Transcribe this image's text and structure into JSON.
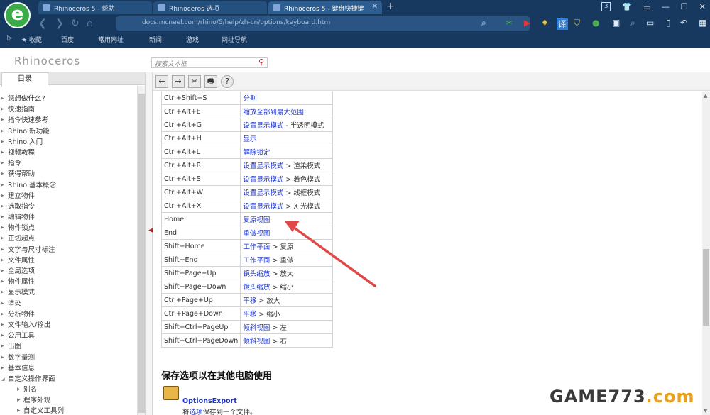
{
  "browser": {
    "logo": "e",
    "tabs": [
      "Rhinoceros 5 - 帮助",
      "Rhinoceros 选项",
      "Rhinoceros 5 - 键盘快捷键"
    ],
    "new_tab": "+",
    "tab_count": "3",
    "url": "docs.mcneel.com/rhino/5/help/zh-cn/options/keyboard.htm",
    "bookmarks": [
      "★ 收藏",
      "百度",
      "常用网址",
      "新闻",
      "游戏",
      "网址导航"
    ]
  },
  "app": {
    "title": "Rhinoceros",
    "search_placeholder": "搜索文本框",
    "toc_tab": "目录"
  },
  "toc": [
    {
      "label": "您想做什么?"
    },
    {
      "label": "快速指南"
    },
    {
      "label": "指令快速参考"
    },
    {
      "label": "Rhino 新功能"
    },
    {
      "label": "Rhino 入门"
    },
    {
      "label": "视频教程"
    },
    {
      "label": "指令"
    },
    {
      "label": "获得帮助"
    },
    {
      "label": "Rhino 基本概念"
    },
    {
      "label": "建立物件"
    },
    {
      "label": "选取指令"
    },
    {
      "label": "编辑物件"
    },
    {
      "label": "物件锁点"
    },
    {
      "label": "正切起点"
    },
    {
      "label": "文字与尺寸标注"
    },
    {
      "label": "文件属性"
    },
    {
      "label": "全局选项"
    },
    {
      "label": "物件属性"
    },
    {
      "label": "显示模式"
    },
    {
      "label": "渲染"
    },
    {
      "label": "分析物件"
    },
    {
      "label": "文件输入/输出"
    },
    {
      "label": "公用工具"
    },
    {
      "label": "出图"
    },
    {
      "label": "数字量测"
    },
    {
      "label": "基本信息"
    },
    {
      "label": "自定义操作界面"
    },
    {
      "label": "别名"
    },
    {
      "label": "程序外观"
    },
    {
      "label": "自定义工具列"
    }
  ],
  "toolbar": {
    "back": "←",
    "forward": "→",
    "tools": "✂",
    "print": "🖶",
    "help": "?"
  },
  "shortcuts": [
    {
      "key": "Ctrl+Shift+S",
      "link": "分割",
      "rest": ""
    },
    {
      "key": "Ctrl+Alt+E",
      "link": "缩放全部到最大范围",
      "rest": ""
    },
    {
      "key": "Ctrl+Alt+G",
      "link": "设置显示模式",
      "rest": " - 半透明模式"
    },
    {
      "key": "Ctrl+Alt+H",
      "link": "显示",
      "rest": ""
    },
    {
      "key": "Ctrl+Alt+L",
      "link": "解除锁定",
      "rest": ""
    },
    {
      "key": "Ctrl+Alt+R",
      "link": "设置显示模式",
      "rest": " > 渲染模式"
    },
    {
      "key": "Ctrl+Alt+S",
      "link": "设置显示模式",
      "rest": " > 着色模式"
    },
    {
      "key": "Ctrl+Alt+W",
      "link": "设置显示模式",
      "rest": " > 线框模式"
    },
    {
      "key": "Ctrl+Alt+X",
      "link": "设置显示模式",
      "rest": " > X 光模式"
    },
    {
      "key": "Home",
      "link": "复原视图",
      "rest": ""
    },
    {
      "key": "End",
      "link": "重做视图",
      "rest": ""
    },
    {
      "key": "Shift+Home",
      "link": "工作平面",
      "rest": " > 复原"
    },
    {
      "key": "Shift+End",
      "link": "工作平面",
      "rest": " > 重做"
    },
    {
      "key": "Shift+Page+Up",
      "link": "镜头缩放",
      "rest": " > 放大"
    },
    {
      "key": "Shift+Page+Down",
      "link": "镜头缩放",
      "rest": " > 缩小"
    },
    {
      "key": "Ctrl+Page+Up",
      "link": "平移",
      "rest": " > 放大"
    },
    {
      "key": "Ctrl+Page+Down",
      "link": "平移",
      "rest": " > 缩小"
    },
    {
      "key": "Shift+Ctrl+PageUp",
      "link": "倾斜视图",
      "rest": " > 左"
    },
    {
      "key": "Shift+Ctrl+PageDown",
      "link": "倾斜视图",
      "rest": " > 右"
    }
  ],
  "section": {
    "heading": "保存选项以在其他电脑使用",
    "item_title": "OptionsExport",
    "item_desc_link": "选项",
    "item_desc_pre": "将",
    "item_desc_post": "保存到一个文件。"
  },
  "watermark": {
    "a": "GAME773",
    "b": ".com"
  },
  "colors": {
    "link": "#1a33cc",
    "arrow": "#e04848",
    "browser_bg": "#17395f"
  }
}
